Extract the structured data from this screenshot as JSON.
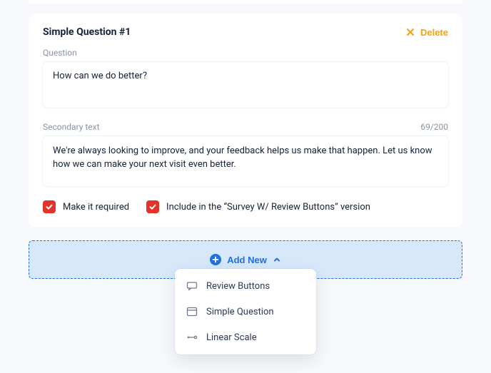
{
  "card": {
    "title": "Simple Question #1",
    "delete_label": "Delete",
    "question_label": "Question",
    "question_value": "How can we do better?",
    "secondary_label": "Secondary text",
    "secondary_counter": "69/200",
    "secondary_value": "We're always looking to improve, and your feedback helps us make that happen. Let us know how we can make your next visit even better.",
    "options": {
      "required_label": "Make it required",
      "required_checked": true,
      "include_label": "Include in the “Survey W/ Review Buttons” version",
      "include_checked": true
    }
  },
  "add_new": {
    "label": "Add New",
    "menu": [
      {
        "icon": "review-buttons-icon",
        "label": "Review Buttons"
      },
      {
        "icon": "simple-question-icon",
        "label": "Simple Question"
      },
      {
        "icon": "linear-scale-icon",
        "label": "Linear Scale"
      }
    ]
  },
  "colors": {
    "accent_blue": "#1f6fe5",
    "accent_red": "#e4322b",
    "accent_orange": "#f2a210"
  }
}
